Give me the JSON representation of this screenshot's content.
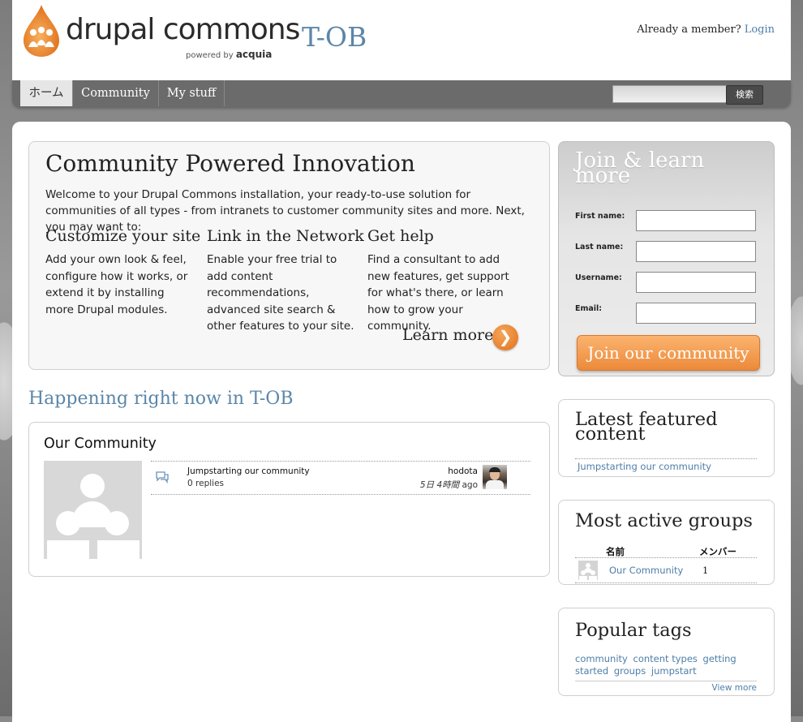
{
  "header": {
    "brand_name": "drupal commons",
    "powered_by": "powered by",
    "powered_brand": "acquia",
    "site_name": "T-OB",
    "already_member": "Already a member?",
    "login_link": "Login"
  },
  "nav": {
    "items": [
      {
        "label": "ホーム",
        "active": true
      },
      {
        "label": "Community",
        "active": false
      },
      {
        "label": "My stuff",
        "active": false
      }
    ],
    "search_button": "検索",
    "search_value": ""
  },
  "welcome": {
    "title": "Community Powered Innovation",
    "intro": "Welcome to your Drupal Commons installation, your ready-to-use solution for communities of all types - from intranets to customer community sites and more. Next, you may want to:",
    "columns": [
      {
        "heading": "Customize your site",
        "text": "Add your own look & feel, configure how it works, or extend it by installing more Drupal modules."
      },
      {
        "heading": "Link in the Network",
        "text": "Enable your free trial to add content recommendations, advanced site search & other features to your site."
      },
      {
        "heading": "Get help",
        "text": "Find a consultant to add new features, get support for what's there, or learn how to grow your community."
      }
    ],
    "learn_more": "Learn more",
    "learn_more_arrow": "❯"
  },
  "join": {
    "title": "Join & learn more",
    "fields": [
      {
        "label": "First name:",
        "value": ""
      },
      {
        "label": "Last name:",
        "value": ""
      },
      {
        "label": "Username:",
        "value": ""
      },
      {
        "label": "Email:",
        "value": ""
      }
    ],
    "button": "Join our community"
  },
  "happening": {
    "heading": "Happening right now in T-OB"
  },
  "community": {
    "title": "Our Community",
    "activity": {
      "title": "Jumpstarting our community",
      "replies": "0 replies",
      "user": "hodota",
      "time_value": "5日 4時間",
      "time_suffix": "ago"
    }
  },
  "featured": {
    "title": "Latest featured content",
    "link": "Jumpstarting our community"
  },
  "active_groups": {
    "title": "Most active groups",
    "col_name": "名前",
    "col_members": "メンバー",
    "rows": [
      {
        "name": "Our Community",
        "members": "1"
      }
    ]
  },
  "popular_tags": {
    "title": "Popular tags",
    "tags": [
      "community",
      "content types",
      "getting",
      "started",
      "groups",
      "jumpstart"
    ],
    "view_more": "View more"
  },
  "colors": {
    "accent_blue": "#5b86a8",
    "link_blue": "#4e7ea8",
    "orange": "#ec8a3a",
    "nav_gray": "#6b6b6b"
  }
}
